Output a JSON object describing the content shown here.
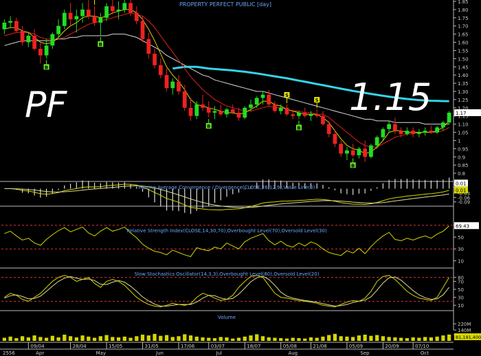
{
  "chart_data": {
    "type": "candlestick",
    "title": "PROPERTY PERFECT PUBLIC [day]",
    "ticker_overlay": "PF",
    "price_overlay": "1.15",
    "last_price_tag": "1.17",
    "price_axis": {
      "ylim": [
        0.75,
        1.85
      ],
      "ticks": [
        "0.8",
        "0.85",
        "0.9",
        "0.95",
        "1",
        "1.05",
        "1.10",
        "1.15",
        "1.20",
        "1.25",
        "1.30",
        "1.35",
        "1.40",
        "1.45",
        "1.50",
        "1.55",
        "1.60",
        "1.65",
        "1.70",
        "1.75",
        "1.80",
        "1.85"
      ]
    },
    "colors": {
      "up": "#22dd22",
      "down": "#ee2222",
      "ma_short": "#d6d600",
      "ma_mid": "#dd2222",
      "ma_long": "#d8d8d8",
      "ma_very_long": "#33d5e8",
      "signal_buy": "#66ee22",
      "signal_sell": "#eeee00"
    },
    "candles": [
      [
        1.68,
        1.74,
        1.65,
        1.72
      ],
      [
        1.72,
        1.76,
        1.69,
        1.73
      ],
      [
        1.73,
        1.75,
        1.66,
        1.67
      ],
      [
        1.67,
        1.7,
        1.58,
        1.6
      ],
      [
        1.6,
        1.66,
        1.57,
        1.64
      ],
      [
        1.64,
        1.68,
        1.55,
        1.56
      ],
      [
        1.56,
        1.6,
        1.47,
        1.52
      ],
      [
        1.52,
        1.62,
        1.5,
        1.58
      ],
      [
        1.58,
        1.66,
        1.56,
        1.65
      ],
      [
        1.65,
        1.74,
        1.62,
        1.7
      ],
      [
        1.7,
        1.8,
        1.68,
        1.78
      ],
      [
        1.78,
        1.84,
        1.7,
        1.74
      ],
      [
        1.74,
        1.8,
        1.66,
        1.76
      ],
      [
        1.76,
        1.84,
        1.72,
        1.8
      ],
      [
        1.8,
        1.86,
        1.74,
        1.76
      ],
      [
        1.76,
        1.82,
        1.7,
        1.72
      ],
      [
        1.72,
        1.78,
        1.64,
        1.75
      ],
      [
        1.75,
        1.84,
        1.73,
        1.82
      ],
      [
        1.82,
        1.86,
        1.77,
        1.79
      ],
      [
        1.79,
        1.85,
        1.74,
        1.8
      ],
      [
        1.8,
        1.86,
        1.78,
        1.84
      ],
      [
        1.84,
        1.86,
        1.76,
        1.78
      ],
      [
        1.78,
        1.82,
        1.71,
        1.73
      ],
      [
        1.73,
        1.76,
        1.6,
        1.62
      ],
      [
        1.62,
        1.66,
        1.5,
        1.53
      ],
      [
        1.53,
        1.56,
        1.44,
        1.46
      ],
      [
        1.46,
        1.5,
        1.38,
        1.4
      ],
      [
        1.4,
        1.44,
        1.3,
        1.32
      ],
      [
        1.32,
        1.38,
        1.28,
        1.36
      ],
      [
        1.36,
        1.4,
        1.28,
        1.3
      ],
      [
        1.3,
        1.34,
        1.18,
        1.2
      ],
      [
        1.2,
        1.26,
        1.12,
        1.15
      ],
      [
        1.15,
        1.24,
        1.13,
        1.22
      ],
      [
        1.22,
        1.28,
        1.18,
        1.2
      ],
      [
        1.2,
        1.24,
        1.14,
        1.17
      ],
      [
        1.17,
        1.21,
        1.13,
        1.18
      ],
      [
        1.18,
        1.22,
        1.15,
        1.16
      ],
      [
        1.16,
        1.2,
        1.14,
        1.19
      ],
      [
        1.19,
        1.22,
        1.16,
        1.17
      ],
      [
        1.17,
        1.2,
        1.12,
        1.14
      ],
      [
        1.14,
        1.21,
        1.13,
        1.2
      ],
      [
        1.2,
        1.25,
        1.18,
        1.22
      ],
      [
        1.22,
        1.27,
        1.2,
        1.26
      ],
      [
        1.26,
        1.3,
        1.22,
        1.28
      ],
      [
        1.28,
        1.31,
        1.21,
        1.22
      ],
      [
        1.22,
        1.24,
        1.17,
        1.18
      ],
      [
        1.18,
        1.22,
        1.16,
        1.2
      ],
      [
        1.2,
        1.22,
        1.15,
        1.16
      ],
      [
        1.16,
        1.19,
        1.13,
        1.15
      ],
      [
        1.15,
        1.18,
        1.13,
        1.17
      ],
      [
        1.17,
        1.2,
        1.14,
        1.15
      ],
      [
        1.15,
        1.18,
        1.12,
        1.16
      ],
      [
        1.16,
        1.19,
        1.14,
        1.15
      ],
      [
        1.15,
        1.18,
        1.09,
        1.1
      ],
      [
        1.1,
        1.12,
        1.02,
        1.04
      ],
      [
        1.04,
        1.06,
        0.96,
        0.98
      ],
      [
        0.98,
        1.0,
        0.9,
        0.92
      ],
      [
        0.92,
        0.96,
        0.88,
        0.94
      ],
      [
        0.94,
        0.98,
        0.9,
        0.91
      ],
      [
        0.91,
        0.96,
        0.89,
        0.95
      ],
      [
        0.95,
        1.0,
        0.87,
        0.9
      ],
      [
        0.9,
        0.98,
        0.89,
        0.97
      ],
      [
        0.97,
        1.03,
        0.95,
        1.02
      ],
      [
        1.02,
        1.08,
        1.0,
        1.07
      ],
      [
        1.07,
        1.12,
        1.05,
        1.1
      ],
      [
        1.1,
        1.14,
        1.04,
        1.06
      ],
      [
        1.06,
        1.08,
        1.02,
        1.04
      ],
      [
        1.04,
        1.08,
        1.03,
        1.06
      ],
      [
        1.06,
        1.08,
        1.02,
        1.04
      ],
      [
        1.04,
        1.07,
        1.02,
        1.05
      ],
      [
        1.05,
        1.08,
        1.03,
        1.06
      ],
      [
        1.06,
        1.09,
        1.04,
        1.05
      ],
      [
        1.05,
        1.09,
        1.04,
        1.08
      ],
      [
        1.08,
        1.12,
        1.06,
        1.11
      ],
      [
        1.11,
        1.18,
        1.1,
        1.17
      ]
    ],
    "ma_short": [
      1.68,
      1.69,
      1.69,
      1.67,
      1.66,
      1.63,
      1.6,
      1.59,
      1.6,
      1.63,
      1.67,
      1.7,
      1.72,
      1.75,
      1.76,
      1.76,
      1.75,
      1.76,
      1.78,
      1.79,
      1.8,
      1.8,
      1.78,
      1.74,
      1.68,
      1.61,
      1.53,
      1.45,
      1.4,
      1.36,
      1.31,
      1.25,
      1.22,
      1.21,
      1.2,
      1.19,
      1.18,
      1.17,
      1.17,
      1.16,
      1.17,
      1.19,
      1.21,
      1.24,
      1.24,
      1.22,
      1.21,
      1.19,
      1.18,
      1.17,
      1.16,
      1.16,
      1.16,
      1.14,
      1.11,
      1.06,
      1.01,
      0.97,
      0.95,
      0.94,
      0.92,
      0.93,
      0.96,
      1.0,
      1.05,
      1.06,
      1.06,
      1.05,
      1.05,
      1.05,
      1.05,
      1.05,
      1.06,
      1.08,
      1.12
    ],
    "ma_mid": [
      1.64,
      1.65,
      1.66,
      1.66,
      1.66,
      1.65,
      1.63,
      1.62,
      1.62,
      1.62,
      1.63,
      1.65,
      1.67,
      1.69,
      1.71,
      1.72,
      1.73,
      1.74,
      1.75,
      1.76,
      1.77,
      1.78,
      1.77,
      1.76,
      1.73,
      1.69,
      1.64,
      1.59,
      1.54,
      1.49,
      1.44,
      1.39,
      1.35,
      1.31,
      1.28,
      1.25,
      1.23,
      1.21,
      1.2,
      1.19,
      1.18,
      1.18,
      1.19,
      1.2,
      1.21,
      1.2,
      1.2,
      1.19,
      1.18,
      1.18,
      1.17,
      1.17,
      1.16,
      1.16,
      1.14,
      1.11,
      1.08,
      1.05,
      1.02,
      0.99,
      0.97,
      0.96,
      0.96,
      0.98,
      1.0,
      1.02,
      1.03,
      1.04,
      1.04,
      1.05,
      1.05,
      1.05,
      1.05,
      1.06,
      1.08
    ],
    "ma_long": [
      1.58,
      1.59,
      1.6,
      1.61,
      1.61,
      1.61,
      1.61,
      1.61,
      1.61,
      1.62,
      1.62,
      1.63,
      1.63,
      1.64,
      1.64,
      1.64,
      1.64,
      1.64,
      1.65,
      1.65,
      1.65,
      1.64,
      1.63,
      1.61,
      1.59,
      1.57,
      1.55,
      1.52,
      1.5,
      1.48,
      1.46,
      1.44,
      1.42,
      1.4,
      1.39,
      1.37,
      1.36,
      1.35,
      1.34,
      1.33,
      1.32,
      1.31,
      1.3,
      1.3,
      1.29,
      1.28,
      1.27,
      1.26,
      1.25,
      1.24,
      1.23,
      1.22,
      1.21,
      1.2,
      1.19,
      1.18,
      1.17,
      1.16,
      1.15,
      1.14,
      1.13,
      1.13,
      1.12,
      1.12,
      1.12,
      1.11,
      1.11,
      1.11,
      1.11,
      1.11,
      1.1,
      1.1,
      1.1,
      1.1,
      1.1
    ],
    "ma_very_long": [
      1.44,
      1.445,
      1.45,
      1.45,
      1.45,
      1.445,
      1.44,
      1.437,
      1.434,
      1.431,
      1.428,
      1.424,
      1.42,
      1.415,
      1.41,
      1.404,
      1.398,
      1.392,
      1.386,
      1.38,
      1.373,
      1.366,
      1.359,
      1.352,
      1.345,
      1.338,
      1.331,
      1.324,
      1.317,
      1.31,
      1.303,
      1.297,
      1.291,
      1.285,
      1.279,
      1.273,
      1.268,
      1.263,
      1.258,
      1.254,
      1.25,
      1.247,
      1.245,
      1.243,
      1.242,
      1.241,
      1.24
    ],
    "ma_very_long_start_index": 28,
    "signals": [
      {
        "type": "S",
        "label": "S",
        "index": 15
      },
      {
        "type": "S",
        "label": "S",
        "index": 19
      },
      {
        "type": "B",
        "label": "B",
        "index": 7
      },
      {
        "type": "B",
        "label": "B",
        "index": 16
      },
      {
        "type": "S",
        "label": "S",
        "index": 47
      },
      {
        "type": "S",
        "label": "S",
        "index": 52
      },
      {
        "type": "B",
        "label": "B",
        "index": 34
      },
      {
        "type": "B",
        "label": "B",
        "index": 49
      },
      {
        "type": "B",
        "label": "B",
        "index": 58
      }
    ],
    "x_tick_labels": [
      "09/04",
      "28/04",
      "15/05",
      "31/05",
      "17/06",
      "03/07",
      "18/07",
      "05/08",
      "21/08",
      "05/09",
      "20/09",
      "07/10"
    ],
    "month_labels": [
      "2556",
      "Apr",
      "May",
      "Jun",
      "Jul",
      "Aug",
      "Sep",
      "Oct"
    ],
    "panels": [
      {
        "id": "macd",
        "title": "Moving Average Convergence / Divergence(CLOSE,26,12,9),Value Line(0)",
        "ticks": [
          "0.03",
          "0.01",
          "-0.03",
          "-0.06",
          "-0.09"
        ],
        "value_tags": [
          "0.01",
          "0.01"
        ],
        "ylim": [
          -0.11,
          0.04
        ]
      },
      {
        "id": "rsi",
        "title": "Relative Strength Index(CLOSE,14,30,70),Overbought Level(70),Oversold Level(30)",
        "ticks": [
          "70",
          "50",
          "30",
          "10"
        ],
        "value_tag": "69.43",
        "ylim": [
          0,
          100
        ],
        "levels": [
          70,
          30
        ],
        "values": [
          56,
          60,
          52,
          45,
          48,
          40,
          36,
          46,
          54,
          61,
          66,
          59,
          63,
          67,
          57,
          52,
          60,
          66,
          60,
          63,
          67,
          57,
          49,
          38,
          31,
          26,
          24,
          20,
          28,
          24,
          20,
          17,
          32,
          29,
          27,
          33,
          30,
          40,
          35,
          30,
          42,
          48,
          52,
          56,
          44,
          37,
          43,
          36,
          33,
          40,
          35,
          42,
          38,
          30,
          24,
          21,
          19,
          27,
          23,
          31,
          22,
          34,
          44,
          52,
          58,
          46,
          44,
          48,
          45,
          49,
          52,
          48,
          55,
          60,
          69
        ]
      },
      {
        "id": "stoch",
        "title": "Slow Stochastics Oscillator(14,3,3),Overbought Level(80),Oversold Level(20)",
        "ticks": [
          "80",
          "70",
          "50",
          "30",
          "10"
        ],
        "ylim": [
          0,
          100
        ],
        "levels": [
          80,
          20
        ],
        "k": [
          30,
          40,
          35,
          25,
          20,
          30,
          40,
          55,
          70,
          80,
          85,
          80,
          70,
          75,
          80,
          65,
          55,
          70,
          75,
          70,
          60,
          45,
          30,
          20,
          12,
          8,
          6,
          10,
          15,
          12,
          10,
          14,
          30,
          40,
          35,
          28,
          22,
          25,
          35,
          55,
          70,
          82,
          85,
          80,
          60,
          40,
          30,
          28,
          25,
          22,
          20,
          18,
          15,
          10,
          8,
          6,
          12,
          18,
          22,
          20,
          28,
          45,
          70,
          82,
          85,
          75,
          60,
          45,
          35,
          28,
          25,
          22,
          30,
          55,
          80
        ],
        "d": [
          28,
          34,
          36,
          32,
          26,
          27,
          33,
          45,
          58,
          70,
          78,
          82,
          78,
          75,
          76,
          72,
          63,
          62,
          68,
          72,
          68,
          58,
          45,
          31,
          21,
          13,
          8,
          8,
          10,
          12,
          12,
          12,
          18,
          28,
          35,
          34,
          28,
          25,
          27,
          38,
          53,
          69,
          79,
          83,
          75,
          60,
          43,
          33,
          28,
          25,
          22,
          20,
          18,
          14,
          11,
          8,
          9,
          12,
          17,
          20,
          23,
          31,
          48,
          66,
          79,
          81,
          73,
          60,
          47,
          36,
          29,
          25,
          26,
          36,
          55
        ]
      },
      {
        "id": "volume",
        "title": "Volume",
        "ticks": [
          "220M",
          "140M",
          "80M"
        ],
        "value_tag": "81,191,400",
        "values_m": [
          40,
          55,
          35,
          60,
          45,
          70,
          50,
          40,
          65,
          45,
          80,
          60,
          45,
          70,
          55,
          40,
          60,
          75,
          50,
          45,
          55,
          40,
          60,
          80,
          70,
          90,
          65,
          75,
          50,
          60,
          85,
          70,
          55,
          45,
          40,
          35,
          50,
          45,
          30,
          40,
          55,
          70,
          85,
          60,
          45,
          40,
          35,
          30,
          40,
          35,
          30,
          45,
          40,
          55,
          75,
          90,
          60,
          55,
          50,
          70,
          80,
          65,
          75,
          60,
          50,
          45,
          40,
          35,
          45,
          40,
          50,
          45,
          55,
          70,
          81
        ]
      }
    ]
  }
}
